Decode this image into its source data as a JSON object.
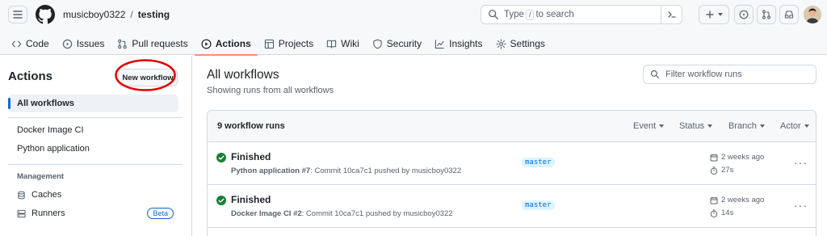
{
  "header": {
    "owner": "musicboy0322",
    "separator": "/",
    "repo": "testing",
    "search_prefix": "Type",
    "search_key": "/",
    "search_suffix": "to search"
  },
  "nav": [
    {
      "label": "Code",
      "icon": "code-icon"
    },
    {
      "label": "Issues",
      "icon": "issue-icon"
    },
    {
      "label": "Pull requests",
      "icon": "pull-request-icon"
    },
    {
      "label": "Actions",
      "icon": "play-icon",
      "active": true
    },
    {
      "label": "Projects",
      "icon": "table-icon"
    },
    {
      "label": "Wiki",
      "icon": "book-icon"
    },
    {
      "label": "Security",
      "icon": "shield-icon"
    },
    {
      "label": "Insights",
      "icon": "graph-icon"
    },
    {
      "label": "Settings",
      "icon": "gear-icon"
    }
  ],
  "sidebar": {
    "title": "Actions",
    "new_workflow_label": "New workflow",
    "all_workflows": "All workflows",
    "workflows": [
      "Docker Image CI",
      "Python application"
    ],
    "management_heading": "Management",
    "caches": "Caches",
    "runners": "Runners",
    "beta_badge": "Beta"
  },
  "main": {
    "title": "All workflows",
    "subtitle": "Showing runs from all workflows",
    "filter_placeholder": "Filter workflow runs",
    "runs_count": "9 workflow runs",
    "filters": [
      "Event",
      "Status",
      "Branch",
      "Actor"
    ],
    "runs": [
      {
        "status": "Finished",
        "workflow": "Python application #7",
        "description": ": Commit 10ca7c1 pushed by musicboy0322",
        "branch": "master",
        "when": "2 weeks ago",
        "duration": "27s"
      },
      {
        "status": "Finished",
        "workflow": "Docker Image CI #2",
        "description": ": Commit 10ca7c1 pushed by musicboy0322",
        "branch": "master",
        "when": "2 weeks ago",
        "duration": "14s"
      }
    ]
  },
  "colors": {
    "accent": "#0969da",
    "success": "#1a7f37",
    "nav_underline": "#fd8c73",
    "annotation": "#e00000"
  }
}
